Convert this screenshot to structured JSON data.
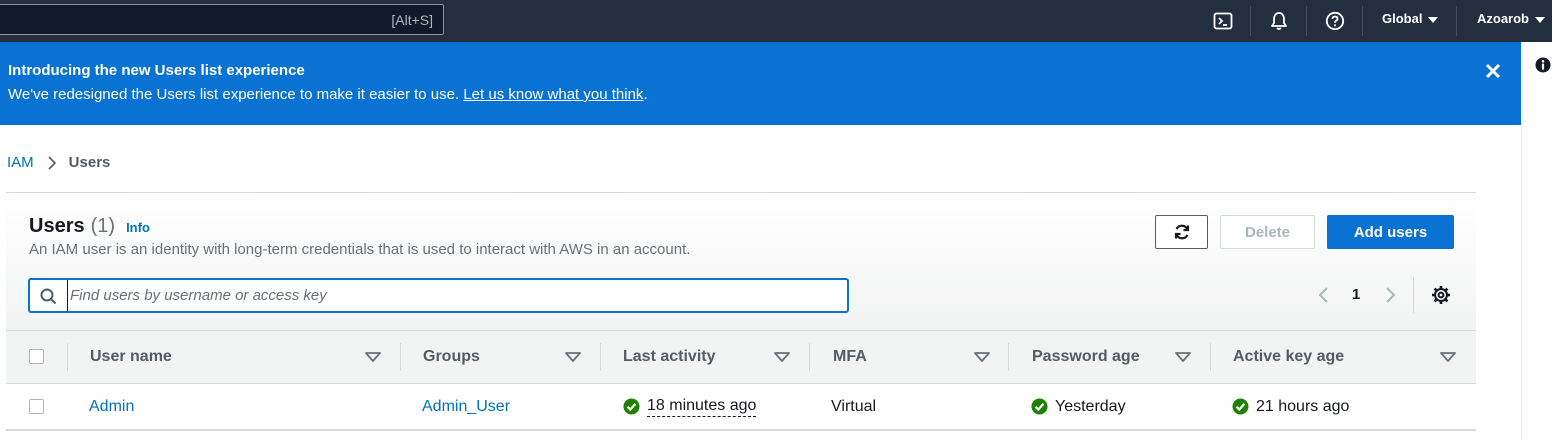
{
  "topnav": {
    "search_shortcut": "[Alt+S]",
    "region_label": "Global",
    "account_label": "Azoarob",
    "icons": [
      "cloudshell-icon",
      "bell-icon",
      "help-icon"
    ]
  },
  "flash": {
    "title": "Introducing the new Users list experience",
    "body": "We've redesigned the Users list experience to make it easier to use.",
    "link": "Let us know what you think",
    "trailing": "."
  },
  "breadcrumb": {
    "root": "IAM",
    "current": "Users"
  },
  "users_panel": {
    "title": "Users",
    "count": "(1)",
    "info": "Info",
    "description": "An IAM user is an identity with long-term credentials that is used to interact with AWS in an account.",
    "delete_label": "Delete",
    "add_label": "Add users",
    "search_placeholder": "Find users by username or access key",
    "page_number": "1"
  },
  "table": {
    "columns": [
      "User name",
      "Groups",
      "Last activity",
      "MFA",
      "Password age",
      "Active key age"
    ],
    "rows": [
      {
        "user_name": "Admin",
        "groups": "Admin_User",
        "last_activity": "18 minutes ago",
        "mfa": "Virtual",
        "password_age": "Yesterday",
        "active_key_age": "21 hours ago"
      }
    ]
  },
  "colors": {
    "nav_bg": "#232f3e",
    "banner_bg": "#0972d3",
    "link": "#0073bb",
    "primary_button": "#0972d3",
    "success": "#1d8102"
  }
}
